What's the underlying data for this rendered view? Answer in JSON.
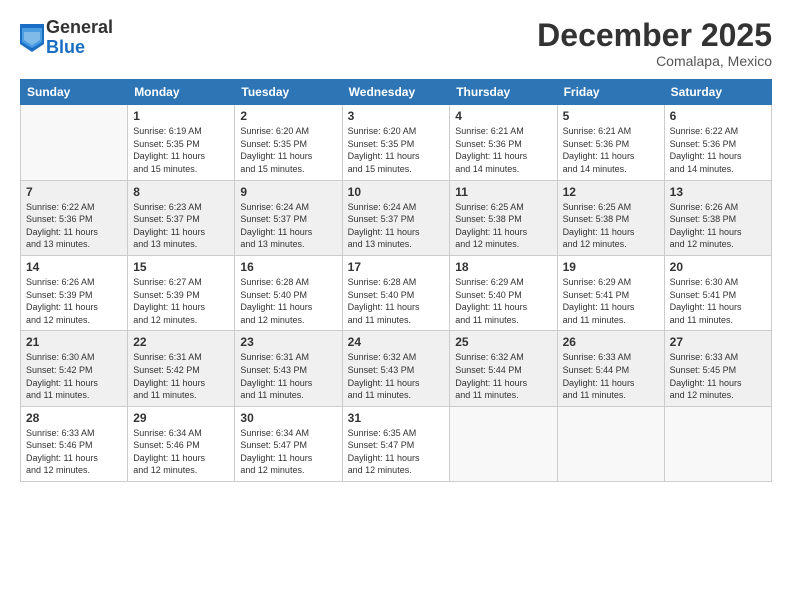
{
  "logo": {
    "general": "General",
    "blue": "Blue"
  },
  "title": "December 2025",
  "location": "Comalapa, Mexico",
  "days_header": [
    "Sunday",
    "Monday",
    "Tuesday",
    "Wednesday",
    "Thursday",
    "Friday",
    "Saturday"
  ],
  "weeks": [
    [
      {
        "num": "",
        "info": ""
      },
      {
        "num": "1",
        "info": "Sunrise: 6:19 AM\nSunset: 5:35 PM\nDaylight: 11 hours\nand 15 minutes."
      },
      {
        "num": "2",
        "info": "Sunrise: 6:20 AM\nSunset: 5:35 PM\nDaylight: 11 hours\nand 15 minutes."
      },
      {
        "num": "3",
        "info": "Sunrise: 6:20 AM\nSunset: 5:35 PM\nDaylight: 11 hours\nand 15 minutes."
      },
      {
        "num": "4",
        "info": "Sunrise: 6:21 AM\nSunset: 5:36 PM\nDaylight: 11 hours\nand 14 minutes."
      },
      {
        "num": "5",
        "info": "Sunrise: 6:21 AM\nSunset: 5:36 PM\nDaylight: 11 hours\nand 14 minutes."
      },
      {
        "num": "6",
        "info": "Sunrise: 6:22 AM\nSunset: 5:36 PM\nDaylight: 11 hours\nand 14 minutes."
      }
    ],
    [
      {
        "num": "7",
        "info": "Sunrise: 6:22 AM\nSunset: 5:36 PM\nDaylight: 11 hours\nand 13 minutes."
      },
      {
        "num": "8",
        "info": "Sunrise: 6:23 AM\nSunset: 5:37 PM\nDaylight: 11 hours\nand 13 minutes."
      },
      {
        "num": "9",
        "info": "Sunrise: 6:24 AM\nSunset: 5:37 PM\nDaylight: 11 hours\nand 13 minutes."
      },
      {
        "num": "10",
        "info": "Sunrise: 6:24 AM\nSunset: 5:37 PM\nDaylight: 11 hours\nand 13 minutes."
      },
      {
        "num": "11",
        "info": "Sunrise: 6:25 AM\nSunset: 5:38 PM\nDaylight: 11 hours\nand 12 minutes."
      },
      {
        "num": "12",
        "info": "Sunrise: 6:25 AM\nSunset: 5:38 PM\nDaylight: 11 hours\nand 12 minutes."
      },
      {
        "num": "13",
        "info": "Sunrise: 6:26 AM\nSunset: 5:38 PM\nDaylight: 11 hours\nand 12 minutes."
      }
    ],
    [
      {
        "num": "14",
        "info": "Sunrise: 6:26 AM\nSunset: 5:39 PM\nDaylight: 11 hours\nand 12 minutes."
      },
      {
        "num": "15",
        "info": "Sunrise: 6:27 AM\nSunset: 5:39 PM\nDaylight: 11 hours\nand 12 minutes."
      },
      {
        "num": "16",
        "info": "Sunrise: 6:28 AM\nSunset: 5:40 PM\nDaylight: 11 hours\nand 12 minutes."
      },
      {
        "num": "17",
        "info": "Sunrise: 6:28 AM\nSunset: 5:40 PM\nDaylight: 11 hours\nand 11 minutes."
      },
      {
        "num": "18",
        "info": "Sunrise: 6:29 AM\nSunset: 5:40 PM\nDaylight: 11 hours\nand 11 minutes."
      },
      {
        "num": "19",
        "info": "Sunrise: 6:29 AM\nSunset: 5:41 PM\nDaylight: 11 hours\nand 11 minutes."
      },
      {
        "num": "20",
        "info": "Sunrise: 6:30 AM\nSunset: 5:41 PM\nDaylight: 11 hours\nand 11 minutes."
      }
    ],
    [
      {
        "num": "21",
        "info": "Sunrise: 6:30 AM\nSunset: 5:42 PM\nDaylight: 11 hours\nand 11 minutes."
      },
      {
        "num": "22",
        "info": "Sunrise: 6:31 AM\nSunset: 5:42 PM\nDaylight: 11 hours\nand 11 minutes."
      },
      {
        "num": "23",
        "info": "Sunrise: 6:31 AM\nSunset: 5:43 PM\nDaylight: 11 hours\nand 11 minutes."
      },
      {
        "num": "24",
        "info": "Sunrise: 6:32 AM\nSunset: 5:43 PM\nDaylight: 11 hours\nand 11 minutes."
      },
      {
        "num": "25",
        "info": "Sunrise: 6:32 AM\nSunset: 5:44 PM\nDaylight: 11 hours\nand 11 minutes."
      },
      {
        "num": "26",
        "info": "Sunrise: 6:33 AM\nSunset: 5:44 PM\nDaylight: 11 hours\nand 11 minutes."
      },
      {
        "num": "27",
        "info": "Sunrise: 6:33 AM\nSunset: 5:45 PM\nDaylight: 11 hours\nand 12 minutes."
      }
    ],
    [
      {
        "num": "28",
        "info": "Sunrise: 6:33 AM\nSunset: 5:46 PM\nDaylight: 11 hours\nand 12 minutes."
      },
      {
        "num": "29",
        "info": "Sunrise: 6:34 AM\nSunset: 5:46 PM\nDaylight: 11 hours\nand 12 minutes."
      },
      {
        "num": "30",
        "info": "Sunrise: 6:34 AM\nSunset: 5:47 PM\nDaylight: 11 hours\nand 12 minutes."
      },
      {
        "num": "31",
        "info": "Sunrise: 6:35 AM\nSunset: 5:47 PM\nDaylight: 11 hours\nand 12 minutes."
      },
      {
        "num": "",
        "info": ""
      },
      {
        "num": "",
        "info": ""
      },
      {
        "num": "",
        "info": ""
      }
    ]
  ]
}
